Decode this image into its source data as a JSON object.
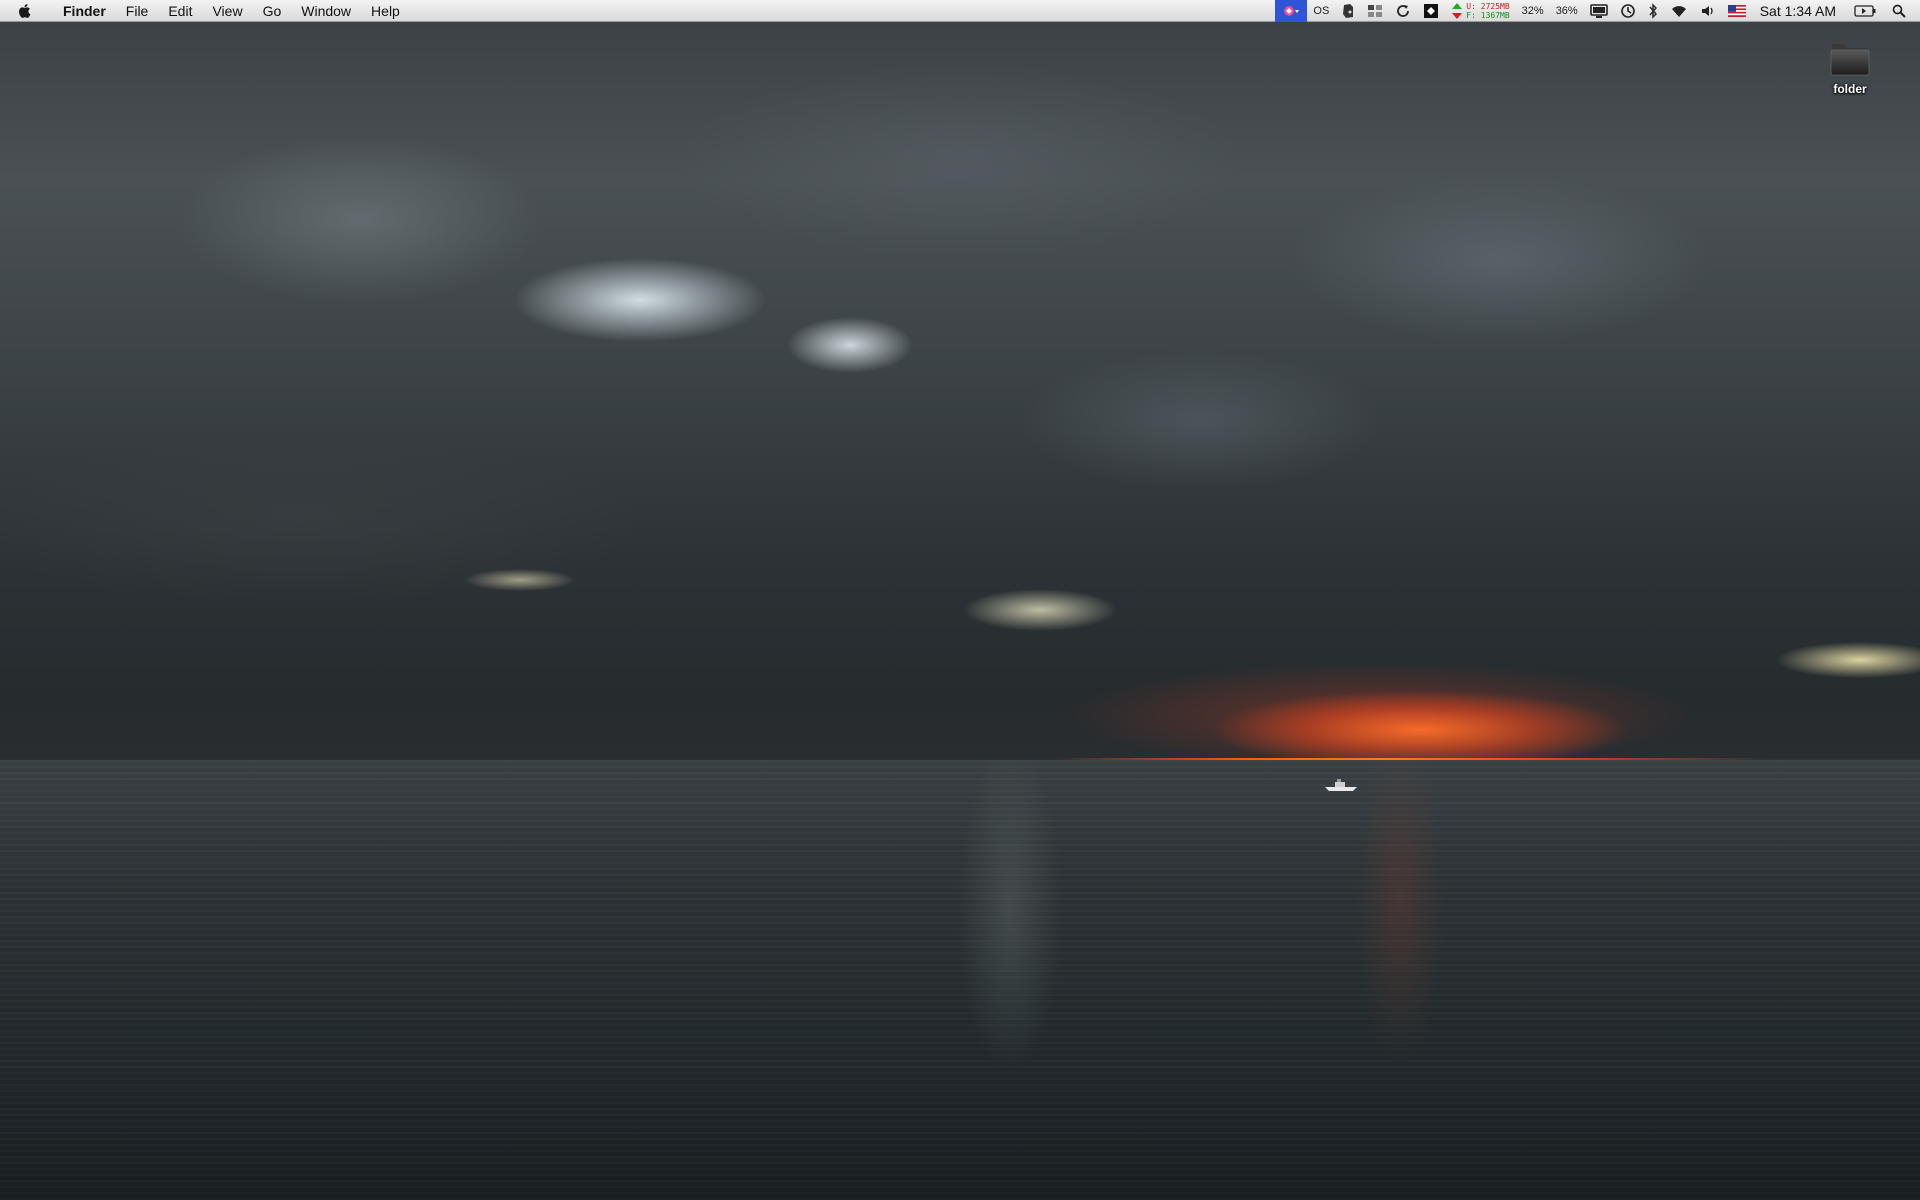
{
  "menubar": {
    "apple_icon": "apple-logo-icon",
    "app_name": "Finder",
    "menus": [
      "File",
      "Edit",
      "View",
      "Go",
      "Window",
      "Help"
    ],
    "status": {
      "os_label": "OS",
      "memory_used": "U: 2725MB",
      "memory_free": "F: 1367MB",
      "cpu1": "32%",
      "cpu2": "36%",
      "clock": "Sat 1:34 AM"
    },
    "status_icons": [
      "app-status-icon",
      "os-icon",
      "evernote-icon",
      "spaces-icon",
      "sync-icon",
      "dropbox-icon",
      "memory-arrows-icon",
      "display-icon",
      "time-machine-icon",
      "bluetooth-icon",
      "wifi-icon",
      "volume-icon",
      "us-flag-icon",
      "battery-icon",
      "spotlight-icon"
    ]
  },
  "desktop": {
    "icons": [
      {
        "label": "folder",
        "icon": "folder-icon"
      }
    ]
  },
  "wallpaper": {
    "description_icon": "sunset-sea-wallpaper",
    "colors": {
      "sky": "#3a4044",
      "sun": "#ff6a22",
      "sea": "#22292c"
    }
  }
}
